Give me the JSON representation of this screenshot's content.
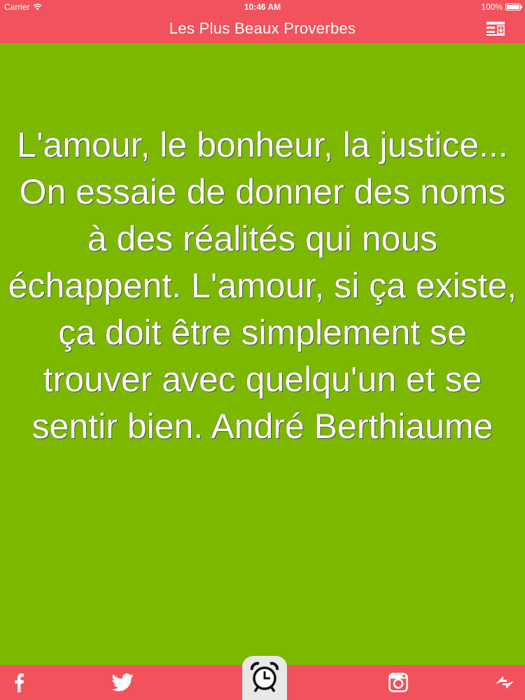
{
  "status_bar": {
    "carrier": "Carrier",
    "time": "10:46 AM",
    "battery": "100%",
    "battery_level": 1.0
  },
  "nav": {
    "title": "Les Plus Beaux Proverbes",
    "menu_icon": "list-download-icon"
  },
  "quote": {
    "text": "L'amour, le bonheur, la justice... On essaie de donner des noms à des réalités qui nous échappent. L'amour, si ça existe, ça doit être simplement se trouver avec quelqu'un et se sentir bien. André Berthiaume"
  },
  "tab_bar": {
    "icons": [
      "facebook-icon",
      "twitter-icon",
      "alarm-clock-icon",
      "instagram-icon",
      "share-icon"
    ]
  },
  "colors": {
    "accent": "#f2525c",
    "background": "#7cb800",
    "text": "#ffffff"
  }
}
